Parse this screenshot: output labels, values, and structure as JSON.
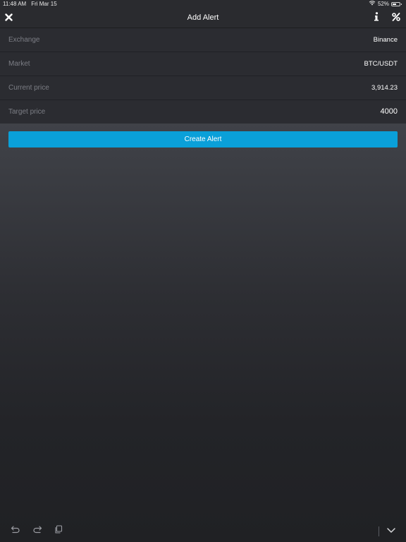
{
  "status_bar": {
    "time": "11:48 AM",
    "date": "Fri Mar 15",
    "battery": "52%",
    "icons": [
      "wifi-icon",
      "battery-icon"
    ]
  },
  "nav": {
    "title": "Add Alert",
    "icons": [
      "close-icon",
      "info-icon",
      "percent-icon"
    ]
  },
  "form": {
    "rows": [
      {
        "label": "Exchange",
        "value": "Binance"
      },
      {
        "label": "Market",
        "value": "BTC/USDT"
      },
      {
        "label": "Current price",
        "value": "3,914.23"
      },
      {
        "label": "Target price",
        "value": "4000"
      }
    ]
  },
  "actions": {
    "create_label": "Create Alert"
  },
  "keyboard_toolbar": {
    "icons": [
      "undo-icon",
      "redo-icon",
      "paste-icon",
      "chevron-down-icon"
    ]
  },
  "colors": {
    "accent": "#0aa0d9",
    "row_background": "#2b2c31",
    "label_text": "#7c7e85"
  }
}
